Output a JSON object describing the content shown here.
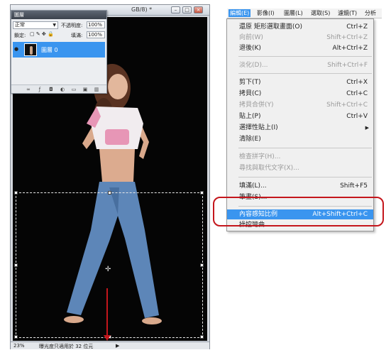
{
  "document": {
    "title": "GB/8) *",
    "zoom": "23%",
    "status": "曝光度只適用於 32 位元",
    "status_arrow": "▶"
  },
  "layers_panel": {
    "title": "圖層",
    "blend_mode": "正常",
    "opacity_label": "不透明度:",
    "opacity_value": "100%",
    "lock_label": "鎖定:",
    "fill_label": "填滿:",
    "fill_value": "100%",
    "layer_name": "圖層 0"
  },
  "menubar": {
    "items": [
      "編輯(E)",
      "影像(I)",
      "圖層(L)",
      "選取(S)",
      "濾鏡(T)",
      "分析"
    ]
  },
  "edit_menu": {
    "items": [
      {
        "label": "還原 矩形選取畫面(O)",
        "shortcut": "Ctrl+Z",
        "state": "normal"
      },
      {
        "label": "向前(W)",
        "shortcut": "Shift+Ctrl+Z",
        "state": "disabled"
      },
      {
        "label": "退後(K)",
        "shortcut": "Alt+Ctrl+Z",
        "state": "normal"
      },
      {
        "label": "淡化(D)...",
        "shortcut": "Shift+Ctrl+F",
        "state": "disabled"
      },
      {
        "label": "剪下(T)",
        "shortcut": "Ctrl+X",
        "state": "normal"
      },
      {
        "label": "拷貝(C)",
        "shortcut": "Ctrl+C",
        "state": "normal"
      },
      {
        "label": "拷貝合併(Y)",
        "shortcut": "Shift+Ctrl+C",
        "state": "disabled"
      },
      {
        "label": "貼上(P)",
        "shortcut": "Ctrl+V",
        "state": "normal"
      },
      {
        "label": "選擇性貼上(I)",
        "shortcut": "",
        "state": "normal"
      },
      {
        "label": "清除(E)",
        "shortcut": "",
        "state": "normal"
      },
      {
        "label": "檢查拼字(H)...",
        "shortcut": "",
        "state": "disabled"
      },
      {
        "label": "尋找與取代文字(X)...",
        "shortcut": "",
        "state": "disabled"
      },
      {
        "label": "填滿(L)...",
        "shortcut": "Shift+F5",
        "state": "normal"
      },
      {
        "label": "筆畫(S)...",
        "shortcut": "",
        "state": "normal"
      },
      {
        "label": "內容感知比例",
        "shortcut": "Alt+Shift+Ctrl+C",
        "state": "highlight"
      },
      {
        "label": "操控彎曲",
        "shortcut": "",
        "state": "normal"
      }
    ]
  },
  "colors": {
    "highlight": "#3a95ef",
    "annotation_red": "#c4161c"
  }
}
